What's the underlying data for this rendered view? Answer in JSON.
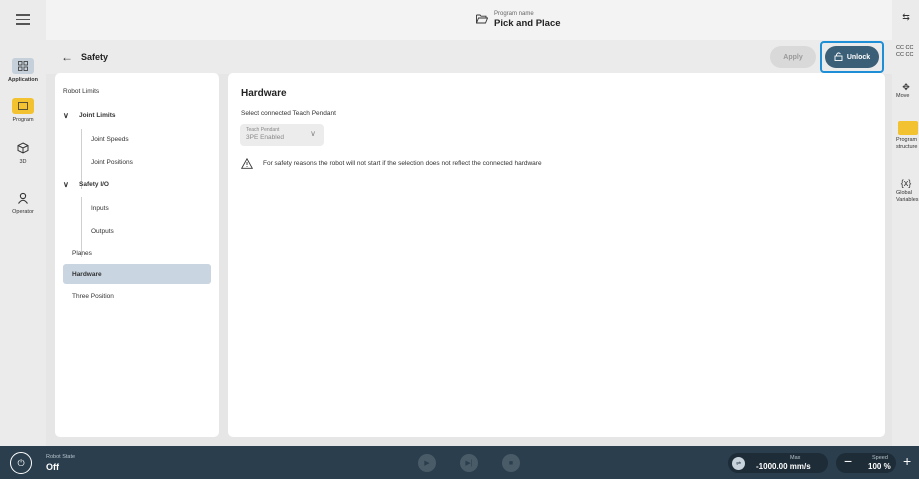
{
  "left_rail": {
    "menu_icon": "hamburger-icon",
    "items": [
      {
        "label": "Application",
        "icon": "grid-icon",
        "active": true
      },
      {
        "label": "Program",
        "icon": "program-icon"
      },
      {
        "label": "3D",
        "icon": "cube-icon"
      },
      {
        "label": "Operator",
        "icon": "user-icon"
      }
    ]
  },
  "topbar": {
    "program_label": "Program name",
    "program_name": "Pick and Place",
    "folder_icon": "folder-open-icon"
  },
  "header": {
    "back_icon": "arrow-left-icon",
    "title": "Safety",
    "apply_label": "Apply",
    "unlock_label": "Unlock",
    "unlock_icon": "lock-icon"
  },
  "nav": {
    "items": [
      {
        "label": "Robot Limits"
      },
      {
        "label": "Joint Limits"
      },
      {
        "label": "Joint Speeds"
      },
      {
        "label": "Joint Positions"
      },
      {
        "label": "Safety I/O"
      },
      {
        "label": "Inputs"
      },
      {
        "label": "Outputs"
      },
      {
        "label": "Planes"
      },
      {
        "label": "Hardware",
        "selected": true
      },
      {
        "label": "Three Position"
      }
    ]
  },
  "main": {
    "title": "Hardware",
    "subtitle": "Select connected Teach Pendant",
    "select": {
      "label": "Teach Pendant",
      "value": "3PE Enabled"
    },
    "warning": "For safety reasons the robot will not start if the selection does not reflect the connected hardware",
    "warning_icon": "warning-triangle-icon"
  },
  "right_rail": {
    "items": [
      {
        "label": "",
        "icon": "handshake-icon"
      },
      {
        "label": "CC CC CC CC",
        "icon": ""
      },
      {
        "label": "Move",
        "icon": "move-icon"
      },
      {
        "label": "Program structure",
        "icon": "list-icon"
      },
      {
        "label": "Global Variables",
        "icon": "variable-icon"
      }
    ]
  },
  "bottombar": {
    "robot_state_label": "Robot State",
    "robot_state_value": "Off",
    "max_label": "Max",
    "max_value": "-1000.00 mm/s",
    "speed_label": "Speed",
    "speed_value": "100 %",
    "minus": "−",
    "plus": "+"
  },
  "colors": {
    "accent": "#1e8fd6",
    "unlock_bg": "#3c5f78",
    "bottom_bar": "#2a3e4d",
    "program_yellow": "#f2c230"
  }
}
